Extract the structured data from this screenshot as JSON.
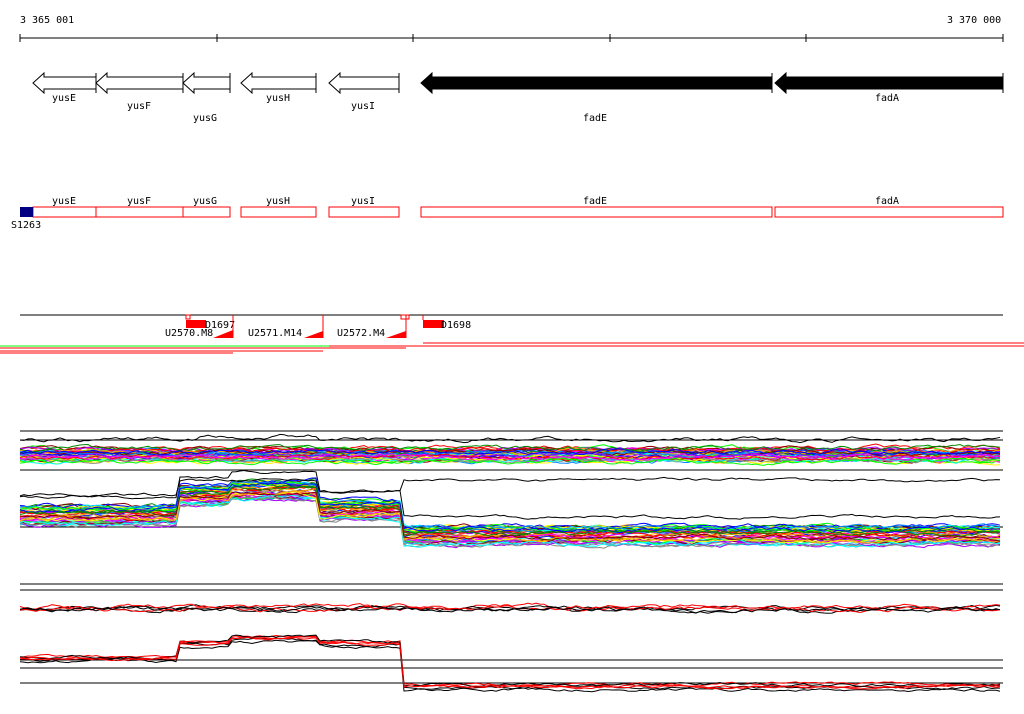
{
  "ruler": {
    "start_label": "3 365 001",
    "end_label": "3 370 000"
  },
  "genes": [
    {
      "name": "yusE",
      "strand": "-",
      "filled": false
    },
    {
      "name": "yusF",
      "strand": "-",
      "filled": false
    },
    {
      "name": "yusG",
      "strand": "-",
      "filled": false
    },
    {
      "name": "yusH",
      "strand": "-",
      "filled": false
    },
    {
      "name": "yusI",
      "strand": "-",
      "filled": false
    },
    {
      "name": "fadE",
      "strand": "-",
      "filled": true
    },
    {
      "name": "fadA",
      "strand": "-",
      "filled": true
    }
  ],
  "cds_track": {
    "marker_label": "S1263",
    "marker_color": "#000080",
    "box_color": "#ff0000"
  },
  "features": {
    "boxes": [
      {
        "label": "D1697"
      },
      {
        "label": "D1698"
      }
    ],
    "units": [
      {
        "label": "U2570.M8"
      },
      {
        "label": "U2571.M14"
      },
      {
        "label": "U2572.M4"
      }
    ]
  },
  "colors": {
    "accent_red": "#ff0000",
    "accent_green": "#00ff00"
  }
}
